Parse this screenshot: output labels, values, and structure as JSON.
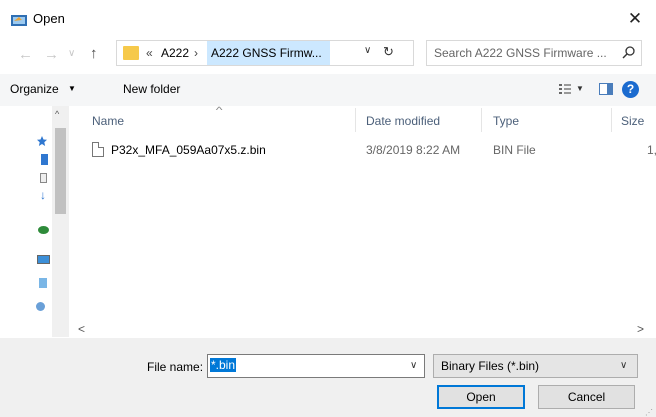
{
  "window": {
    "title": "Open",
    "close_glyph": "✕"
  },
  "nav": {
    "back_glyph": "←",
    "forward_glyph": "→",
    "recent_glyph": "∨",
    "up_glyph": "↑"
  },
  "address": {
    "overflow": "«",
    "crumbs": [
      "A222",
      "A222 GNSS Firmw..."
    ],
    "separator": "›",
    "dropdown_glyph": "∨",
    "refresh_glyph": "↻"
  },
  "search": {
    "placeholder": "Search A222 GNSS Firmware ..."
  },
  "toolbar": {
    "organize": "Organize",
    "dropdown_glyph": "▼",
    "new_folder": "New folder",
    "help": "?"
  },
  "columns": {
    "name": "Name",
    "date": "Date modified",
    "type": "Type",
    "size": "Size",
    "sort_glyph": "^"
  },
  "files": [
    {
      "name": "P32x_MFA_059Aa07x5.z.bin",
      "date": "3/8/2019 8:22 AM",
      "type": "BIN File",
      "size": "1,"
    }
  ],
  "scroll": {
    "left": "<",
    "right": ">",
    "up": "^"
  },
  "footer": {
    "file_name_label": "File name:",
    "file_name_value": "*.bin",
    "filter_value": "Binary Files (*.bin)",
    "open_label": "Open",
    "cancel_label": "Cancel",
    "dropdown_glyph": "∨"
  },
  "colors": {
    "accent": "#0078d7",
    "selection": "#cce8ff",
    "toolbar": "#f5f6f7",
    "footer": "#f0f0f0"
  }
}
